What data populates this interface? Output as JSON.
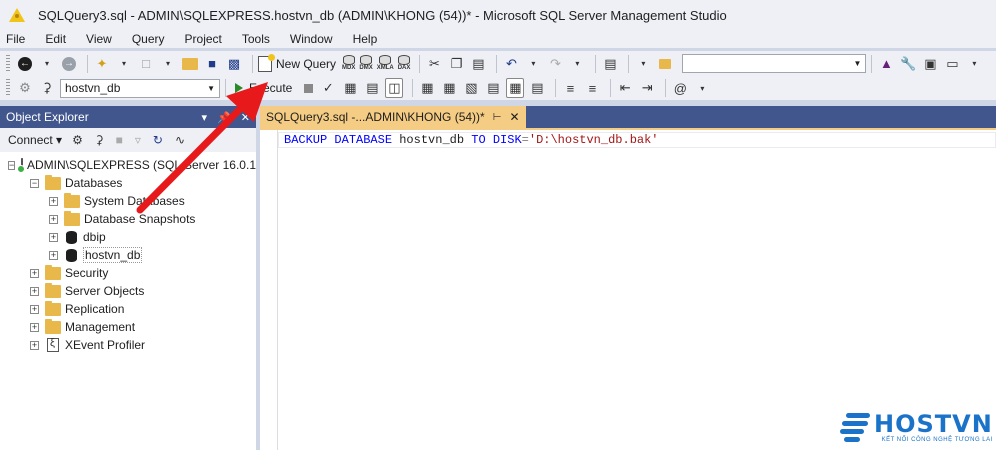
{
  "window": {
    "title": "SQLQuery3.sql - ADMIN\\SQLEXPRESS.hostvn_db (ADMIN\\KHONG (54))* - Microsoft SQL Server Management Studio"
  },
  "menu": [
    "File",
    "Edit",
    "View",
    "Query",
    "Project",
    "Tools",
    "Window",
    "Help"
  ],
  "toolbar1": {
    "new_query_label": "New Query",
    "mini_db_labels": [
      "MDX",
      "DMX",
      "XMLA",
      "DAX"
    ],
    "search_combo_value": ""
  },
  "toolbar2": {
    "database_selected": "hostvn_db",
    "execute_label": "Execute"
  },
  "object_explorer": {
    "header": "Object Explorer",
    "connect_label": "Connect",
    "tree": {
      "server": "ADMIN\\SQLEXPRESS (SQL Server 16.0.1",
      "databases": "Databases",
      "system_databases": "System Databases",
      "database_snapshots": "Database Snapshots",
      "dbip": "dbip",
      "hostvn_db": "hostvn_db",
      "security": "Security",
      "server_objects": "Server Objects",
      "replication": "Replication",
      "management": "Management",
      "xevent_profiler": "XEvent Profiler"
    }
  },
  "editor": {
    "tab_title": "SQLQuery3.sql -...ADMIN\\KHONG (54))*",
    "code": {
      "kw1": "BACKUP",
      "kw2": "DATABASE",
      "ident": "hostvn_db",
      "kw3": "TO",
      "kw4": "DISK",
      "op": "=",
      "str": "'D:\\hostvn_db.bak'"
    }
  },
  "logo": {
    "name": "HOSTVN",
    "tagline": "KẾT NỐI CÔNG NGHỆ TƯƠNG LAI"
  },
  "colors": {
    "panel_header": "#40568d",
    "tab_active": "#f5cc84",
    "annotation_arrow": "#e8191b",
    "brand": "#1a73c8"
  }
}
